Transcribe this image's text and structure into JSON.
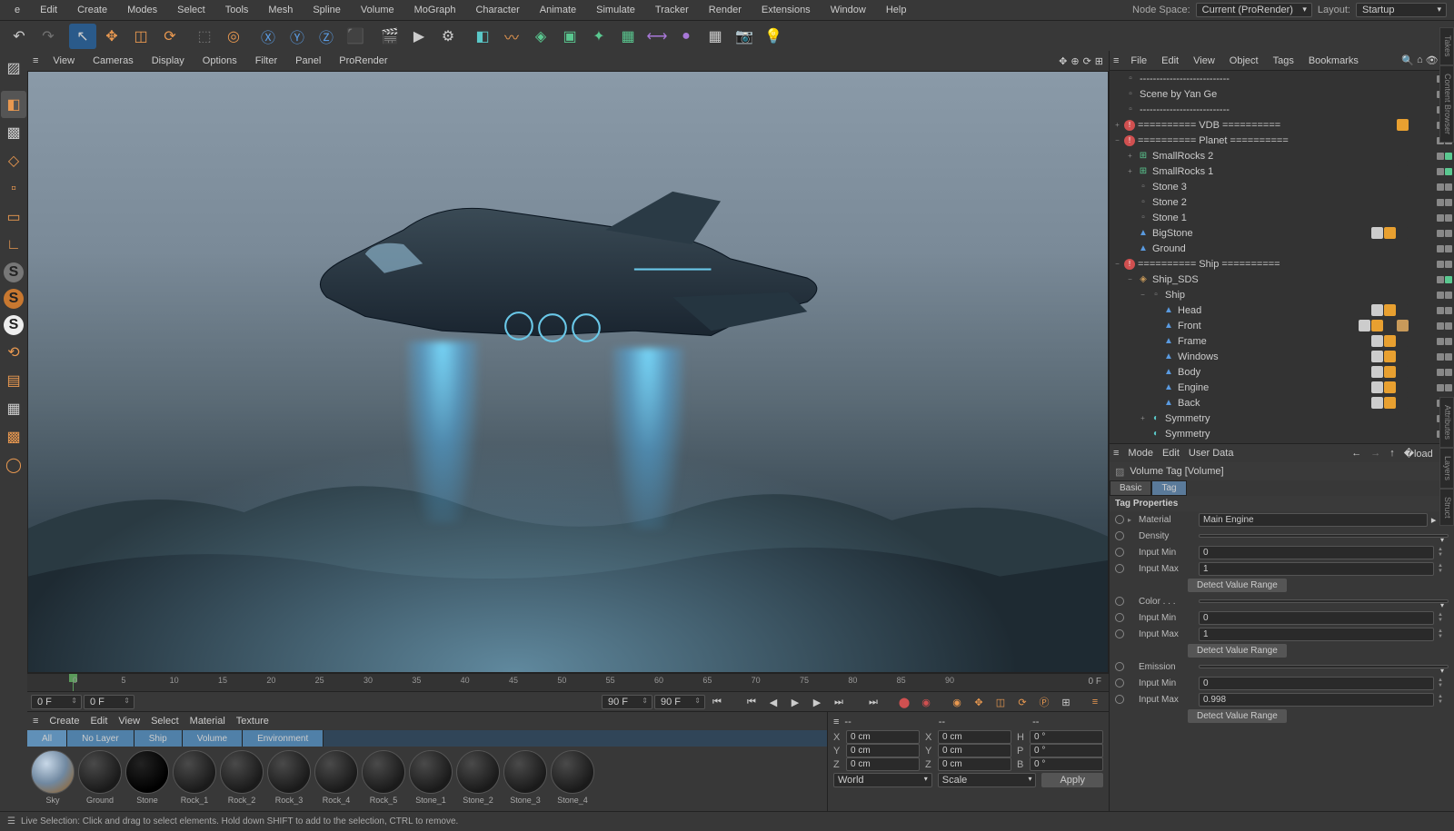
{
  "menubar": [
    "e",
    "Edit",
    "Create",
    "Modes",
    "Select",
    "Tools",
    "Mesh",
    "Spline",
    "Volume",
    "MoGraph",
    "Character",
    "Animate",
    "Simulate",
    "Tracker",
    "Render",
    "Extensions",
    "Window",
    "Help"
  ],
  "nodespace_label": "Node Space:",
  "nodespace_value": "Current (ProRender)",
  "layout_label": "Layout:",
  "layout_value": "Startup",
  "view_menu": [
    "View",
    "Cameras",
    "Display",
    "Options",
    "Filter",
    "Panel",
    "ProRender"
  ],
  "timeline": {
    "start": "0 F",
    "current": "0 F",
    "end": "90 F",
    "end2": "90 F",
    "ticks": [
      0,
      5,
      10,
      15,
      20,
      25,
      30,
      35,
      40,
      45,
      50,
      55,
      60,
      65,
      70,
      75,
      80,
      85,
      90
    ],
    "right": "0 F"
  },
  "mat_menu": [
    "Create",
    "Edit",
    "View",
    "Select",
    "Material",
    "Texture"
  ],
  "mat_tabs": [
    "All",
    "No Layer",
    "Ship",
    "Volume",
    "Environment"
  ],
  "materials": [
    {
      "name": "Sky",
      "cls": "sky"
    },
    {
      "name": "Ground",
      "cls": ""
    },
    {
      "name": "Stone",
      "cls": "black"
    },
    {
      "name": "Rock_1",
      "cls": ""
    },
    {
      "name": "Rock_2",
      "cls": ""
    },
    {
      "name": "Rock_3",
      "cls": ""
    },
    {
      "name": "Rock_4",
      "cls": ""
    },
    {
      "name": "Rock_5",
      "cls": ""
    },
    {
      "name": "Stone_1",
      "cls": ""
    },
    {
      "name": "Stone_2",
      "cls": ""
    },
    {
      "name": "Stone_3",
      "cls": ""
    },
    {
      "name": "Stone_4",
      "cls": ""
    }
  ],
  "coord": {
    "rows": [
      [
        "X",
        "0 cm",
        "X",
        "0 cm",
        "H",
        "0 °"
      ],
      [
        "Y",
        "0 cm",
        "Y",
        "0 cm",
        "P",
        "0 °"
      ],
      [
        "Z",
        "0 cm",
        "Z",
        "0 cm",
        "B",
        "0 °"
      ]
    ],
    "mode1": "World",
    "mode2": "Scale",
    "apply": "Apply",
    "dash": "--"
  },
  "om_menu": [
    "File",
    "Edit",
    "View",
    "Object",
    "Tags",
    "Bookmarks"
  ],
  "tree": [
    {
      "d": 0,
      "exp": "",
      "ico": "null",
      "name": "---------------------------",
      "dots": [
        "#888",
        "#888"
      ],
      "alert": false
    },
    {
      "d": 0,
      "exp": "",
      "ico": "null",
      "name": "Scene by Yan Ge",
      "dots": [
        "#888",
        "#888"
      ]
    },
    {
      "d": 0,
      "exp": "",
      "ico": "null",
      "name": "---------------------------",
      "dots": [
        "#888",
        "#888"
      ]
    },
    {
      "d": 0,
      "exp": "+",
      "ico": "alert",
      "name": "========== VDB ==========",
      "dots": [
        "#888",
        "#888"
      ],
      "tags": [
        "#e8a030"
      ]
    },
    {
      "d": 0,
      "exp": "−",
      "ico": "alert",
      "name": "========== Planet ==========",
      "dots": [
        "#888",
        "#888"
      ]
    },
    {
      "d": 1,
      "exp": "+",
      "ico": "cloner",
      "name": "SmallRocks 2",
      "dots": [
        "#888",
        "#5ac890"
      ],
      "tags": [
        "#333"
      ]
    },
    {
      "d": 1,
      "exp": "+",
      "ico": "cloner",
      "name": "SmallRocks 1",
      "dots": [
        "#888",
        "#5ac890"
      ],
      "tags": [
        "#333"
      ]
    },
    {
      "d": 1,
      "exp": "",
      "ico": "null",
      "name": "Stone 3",
      "dots": [
        "#888",
        "#888"
      ]
    },
    {
      "d": 1,
      "exp": "",
      "ico": "null",
      "name": "Stone 2",
      "dots": [
        "#888",
        "#888"
      ]
    },
    {
      "d": 1,
      "exp": "",
      "ico": "null",
      "name": "Stone 1",
      "dots": [
        "#888",
        "#888"
      ]
    },
    {
      "d": 1,
      "exp": "",
      "ico": "poly",
      "name": "BigStone",
      "dots": [
        "#888",
        "#888"
      ],
      "tags": [
        "#ccc",
        "#e8a030",
        "#333"
      ]
    },
    {
      "d": 1,
      "exp": "",
      "ico": "poly",
      "name": "Ground",
      "dots": [
        "#888",
        "#888"
      ]
    },
    {
      "d": 0,
      "exp": "−",
      "ico": "alert",
      "name": "========== Ship ==========",
      "dots": [
        "#888",
        "#888"
      ]
    },
    {
      "d": 1,
      "exp": "−",
      "ico": "sds",
      "name": "Ship_SDS",
      "dots": [
        "#888",
        "#5ac890"
      ]
    },
    {
      "d": 2,
      "exp": "−",
      "ico": "null",
      "name": "Ship",
      "dots": [
        "#888",
        "#888"
      ]
    },
    {
      "d": 3,
      "exp": "",
      "ico": "poly",
      "name": "Head",
      "dots": [
        "#888",
        "#888"
      ],
      "tags": [
        "#ccc",
        "#e8a030",
        "#333"
      ]
    },
    {
      "d": 3,
      "exp": "",
      "ico": "poly",
      "name": "Front",
      "dots": [
        "#888",
        "#888"
      ],
      "tags": [
        "#ccc",
        "#e8a030",
        "#333",
        "#c89a5a"
      ]
    },
    {
      "d": 3,
      "exp": "",
      "ico": "poly",
      "name": "Frame",
      "dots": [
        "#888",
        "#888"
      ],
      "tags": [
        "#ccc",
        "#e8a030",
        "#333"
      ]
    },
    {
      "d": 3,
      "exp": "",
      "ico": "poly",
      "name": "Windows",
      "dots": [
        "#888",
        "#888"
      ],
      "tags": [
        "#ccc",
        "#e8a030",
        "#333"
      ]
    },
    {
      "d": 3,
      "exp": "",
      "ico": "poly",
      "name": "Body",
      "dots": [
        "#888",
        "#888"
      ],
      "tags": [
        "#ccc",
        "#e8a030",
        "#333"
      ]
    },
    {
      "d": 3,
      "exp": "",
      "ico": "poly",
      "name": "Engine",
      "dots": [
        "#888",
        "#888"
      ],
      "tags": [
        "#ccc",
        "#e8a030",
        "#333"
      ]
    },
    {
      "d": 3,
      "exp": "",
      "ico": "poly",
      "name": "Back",
      "dots": [
        "#888",
        "#888"
      ],
      "tags": [
        "#ccc",
        "#e8a030",
        "#333"
      ]
    },
    {
      "d": 2,
      "exp": "+",
      "ico": "sym",
      "name": "Symmetry",
      "dots": [
        "#888",
        "#5ac890"
      ],
      "tags": [
        "#333"
      ]
    },
    {
      "d": 2,
      "exp": "",
      "ico": "sym",
      "name": "Symmetry",
      "dots": [
        "#888",
        "#5ac890"
      ]
    }
  ],
  "attr_menu": [
    "Mode",
    "Edit",
    "User Data"
  ],
  "attr_title": "Volume Tag [Volume]",
  "attr_tabs": [
    "Basic",
    "Tag"
  ],
  "attr_section": "Tag Properties",
  "attr": {
    "material_label": "Material",
    "material_value": "Main Engine",
    "density_label": "Density",
    "inputmin_label": "Input Min",
    "inputmax_label": "Input Max",
    "im1": "0",
    "ix1": "1",
    "detect": "Detect Value Range",
    "color_label": "Color . . .",
    "im2": "0",
    "ix2": "1",
    "emission_label": "Emission",
    "im3": "0",
    "ix3": "0.998"
  },
  "status": "Live Selection: Click and drag to select elements. Hold down SHIFT to add to the selection, CTRL to remove."
}
